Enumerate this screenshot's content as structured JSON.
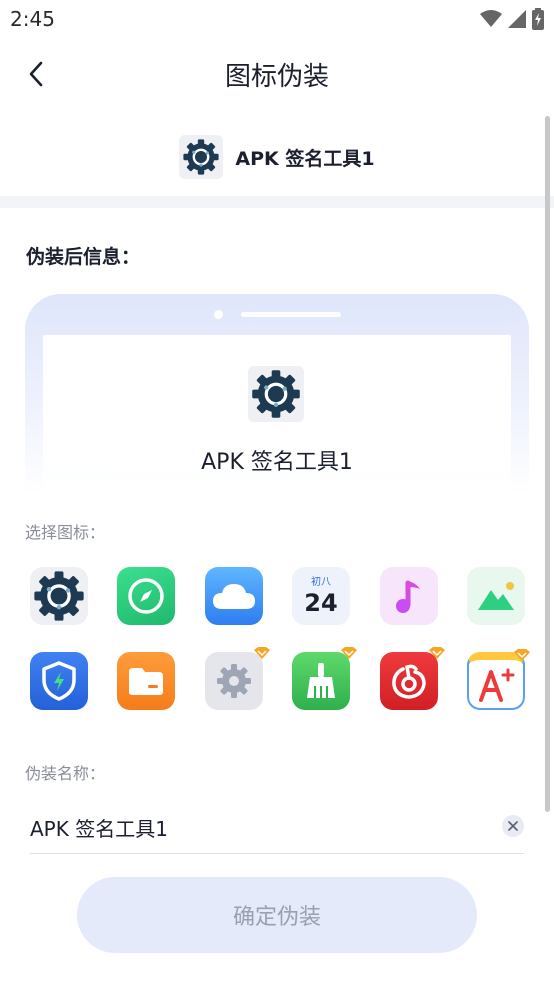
{
  "status_bar": {
    "time": "2:45",
    "icons": [
      "wifi-icon",
      "signal-icon",
      "battery-charging-icon"
    ]
  },
  "app_bar": {
    "back_icon": "chevron-left-icon",
    "title": "图标伪装"
  },
  "app_header": {
    "icon": "gear-icon",
    "name": "APK 签名工具1"
  },
  "preview": {
    "label": "伪装后信息：",
    "icon": "gear-icon",
    "name": "APK 签名工具1"
  },
  "icon_picker": {
    "label": "选择图标：",
    "calendar": {
      "lunar": "初八",
      "day": "24"
    },
    "icons": [
      {
        "id": "gear",
        "icon": "gear-icon",
        "color": "#1e3a52",
        "premium": false
      },
      {
        "id": "compass",
        "icon": "compass-icon",
        "color": "#22c77a",
        "premium": false
      },
      {
        "id": "cloud",
        "icon": "cloud-icon",
        "color": "#2f8ef5",
        "premium": false
      },
      {
        "id": "calendar",
        "icon": "calendar-icon",
        "color": "#2b6fe8",
        "premium": false
      },
      {
        "id": "music",
        "icon": "music-note-icon",
        "color": "#d94fe0",
        "premium": false
      },
      {
        "id": "gallery",
        "icon": "mountain-icon",
        "color": "#3ad68f",
        "premium": false
      },
      {
        "id": "security",
        "icon": "shield-icon",
        "color": "#2f6ee8",
        "premium": false
      },
      {
        "id": "files",
        "icon": "folder-icon",
        "color": "#f98a2a",
        "premium": false
      },
      {
        "id": "settings",
        "icon": "settings-icon",
        "color": "#9ea5b5",
        "premium": true
      },
      {
        "id": "cleaner",
        "icon": "broom-icon",
        "color": "#3fbf5a",
        "premium": true
      },
      {
        "id": "netease-music",
        "icon": "music-disc-icon",
        "color": "#e0272a",
        "premium": true
      },
      {
        "id": "notes",
        "icon": "a-plus-icon",
        "color": "#ee3a3a",
        "premium": true
      }
    ]
  },
  "name_field": {
    "label": "伪装名称：",
    "value": "APK 签名工具1",
    "clear_icon": "close-icon"
  },
  "confirm_button": {
    "label": "确定伪装"
  },
  "colors": {
    "text_primary": "#1c1f2e",
    "text_secondary": "#8a8e99",
    "button_bg": "#e5eafa",
    "button_text": "#9aa0b0",
    "premium_badge": "#f5a623"
  }
}
